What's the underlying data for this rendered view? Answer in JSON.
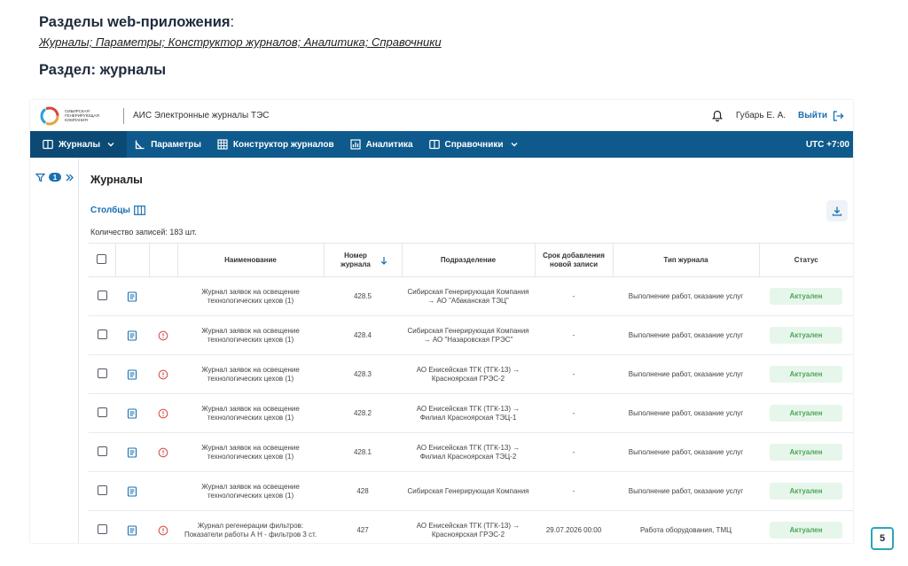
{
  "slide": {
    "title": "Разделы web-приложения",
    "colon": ":",
    "links": "Журналы; Параметры; Конструктор журналов; Аналитика; Справочники",
    "section": "Раздел: журналы",
    "page_number": "5"
  },
  "topbar": {
    "logo_text": "Сибирская генерирующая компания",
    "app_title": "АИС Электронные журналы ТЭС",
    "user": "Губарь Е. А.",
    "logout": "Выйти"
  },
  "nav": {
    "items": [
      {
        "label": "Журналы"
      },
      {
        "label": "Параметры"
      },
      {
        "label": "Конструктор журналов"
      },
      {
        "label": "Аналитика"
      },
      {
        "label": "Справочники"
      }
    ],
    "timezone": "UTC +7:00"
  },
  "sidebar": {
    "filter_count": "1"
  },
  "main": {
    "title": "Журналы",
    "columns_link": "Столбцы",
    "count": "Количество записей: 183 шт."
  },
  "table": {
    "headers": {
      "name": "Наименование",
      "number": "Номер журнала",
      "division": "Подразделение",
      "deadline": "Срок добавления новой записи",
      "type": "Тип журнала",
      "status": "Статус"
    },
    "rows": [
      {
        "name": "Журнал заявок на освещение технологических цехов (1)",
        "number": "428.5",
        "division": "Сибирская Генерирующая Компания → АО \"Абаканская ТЭЦ\"",
        "deadline": "-",
        "type": "Выполнение работ, оказание услуг",
        "status": "Актуален",
        "warning": false
      },
      {
        "name": "Журнал заявок на освещение технологических цехов (1)",
        "number": "428.4",
        "division": "Сибирская Генерирующая Компания → АО \"Назаровская ГРЭС\"",
        "deadline": "-",
        "type": "Выполнение работ, оказание услуг",
        "status": "Актуален",
        "warning": true
      },
      {
        "name": "Журнал заявок на освещение технологических цехов (1)",
        "number": "428.3",
        "division": "АО Енисейская ТГК (ТГК-13) → Красноярская ГРЭС-2",
        "deadline": "-",
        "type": "Выполнение работ, оказание услуг",
        "status": "Актуален",
        "warning": true
      },
      {
        "name": "Журнал заявок на освещение технологических цехов (1)",
        "number": "428.2",
        "division": "АО Енисейская ТГК (ТГК-13) → Филиал Красноярская ТЭЦ-1",
        "deadline": "-",
        "type": "Выполнение работ, оказание услуг",
        "status": "Актуален",
        "warning": true
      },
      {
        "name": "Журнал заявок на освещение технологических цехов (1)",
        "number": "428.1",
        "division": "АО Енисейская ТГК (ТГК-13) → Филиал Красноярская ТЭЦ-2",
        "deadline": "-",
        "type": "Выполнение работ, оказание услуг",
        "status": "Актуален",
        "warning": true
      },
      {
        "name": "Журнал заявок на освещение технологических цехов (1)",
        "number": "428",
        "division": "Сибирская Генерирующая Компания",
        "deadline": "-",
        "type": "Выполнение работ, оказание услуг",
        "status": "Актуален",
        "warning": false
      },
      {
        "name": "Журнал регенерации фильтров: Показатели работы А Н - фильтров 3 ст.",
        "number": "427",
        "division": "АО Енисейская ТГК (ТГК-13) → Красноярская ГРЭС-2",
        "deadline": "29.07.2026 00:00",
        "type": "Работа оборудования, ТМЦ",
        "status": "Актуален",
        "warning": true
      }
    ]
  },
  "colors": {
    "nav_bg": "#0f5a8c",
    "accent": "#1a6fb0",
    "status_bg": "#e7f6ea",
    "status_text": "#4ba45a",
    "warning": "#d9534f"
  }
}
